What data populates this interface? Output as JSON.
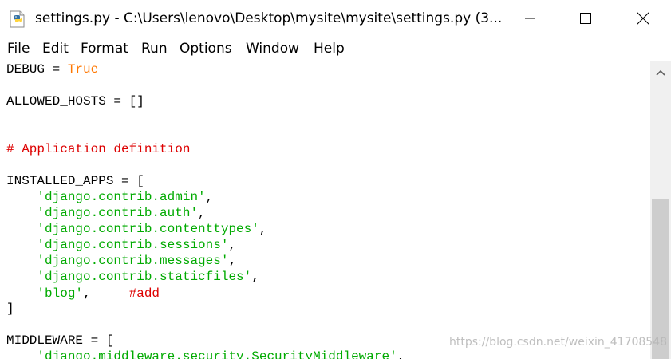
{
  "window": {
    "title": "settings.py - C:\\Users\\lenovo\\Desktop\\mysite\\mysite\\settings.py (3...",
    "icons": {
      "app": "python-idle-icon",
      "minimize": "minimize-icon",
      "maximize": "maximize-icon",
      "close": "close-icon",
      "scroll_up": "chevron-up-icon"
    }
  },
  "menu": {
    "items": [
      {
        "label": "File"
      },
      {
        "label": "Edit"
      },
      {
        "label": "Format"
      },
      {
        "label": "Run"
      },
      {
        "label": "Options"
      },
      {
        "label": "Window"
      },
      {
        "label": "Help"
      }
    ]
  },
  "colors": {
    "keyword": "#ff7700",
    "comment": "#dd0000",
    "string": "#00aa00",
    "text": "#000000"
  },
  "editor": {
    "lines": [
      [
        {
          "t": "DEBUG = ",
          "k": "normal"
        },
        {
          "t": "True",
          "k": "kw"
        }
      ],
      [],
      [
        {
          "t": "ALLOWED_HOSTS = []",
          "k": "normal"
        }
      ],
      [],
      [],
      [
        {
          "t": "# Application definition",
          "k": "comment"
        }
      ],
      [],
      [
        {
          "t": "INSTALLED_APPS = [",
          "k": "normal"
        }
      ],
      [
        {
          "t": "    ",
          "k": "normal"
        },
        {
          "t": "'django.contrib.admin'",
          "k": "str"
        },
        {
          "t": ",",
          "k": "normal"
        }
      ],
      [
        {
          "t": "    ",
          "k": "normal"
        },
        {
          "t": "'django.contrib.auth'",
          "k": "str"
        },
        {
          "t": ",",
          "k": "normal"
        }
      ],
      [
        {
          "t": "    ",
          "k": "normal"
        },
        {
          "t": "'django.contrib.contenttypes'",
          "k": "str"
        },
        {
          "t": ",",
          "k": "normal"
        }
      ],
      [
        {
          "t": "    ",
          "k": "normal"
        },
        {
          "t": "'django.contrib.sessions'",
          "k": "str"
        },
        {
          "t": ",",
          "k": "normal"
        }
      ],
      [
        {
          "t": "    ",
          "k": "normal"
        },
        {
          "t": "'django.contrib.messages'",
          "k": "str"
        },
        {
          "t": ",",
          "k": "normal"
        }
      ],
      [
        {
          "t": "    ",
          "k": "normal"
        },
        {
          "t": "'django.contrib.staticfiles'",
          "k": "str"
        },
        {
          "t": ",",
          "k": "normal"
        }
      ],
      [
        {
          "t": "    ",
          "k": "normal"
        },
        {
          "t": "'blog'",
          "k": "str"
        },
        {
          "t": ",     ",
          "k": "normal"
        },
        {
          "t": "#add",
          "k": "comment"
        },
        {
          "cursor": true
        }
      ],
      [
        {
          "t": "]",
          "k": "normal"
        }
      ],
      [],
      [
        {
          "t": "MIDDLEWARE = [",
          "k": "normal"
        }
      ],
      [
        {
          "t": "    ",
          "k": "normal"
        },
        {
          "t": "'django.middleware.security.SecurityMiddleware'",
          "k": "str"
        },
        {
          "t": ",",
          "k": "normal"
        }
      ]
    ]
  },
  "watermark": "https://blog.csdn.net/weixin_41708548"
}
